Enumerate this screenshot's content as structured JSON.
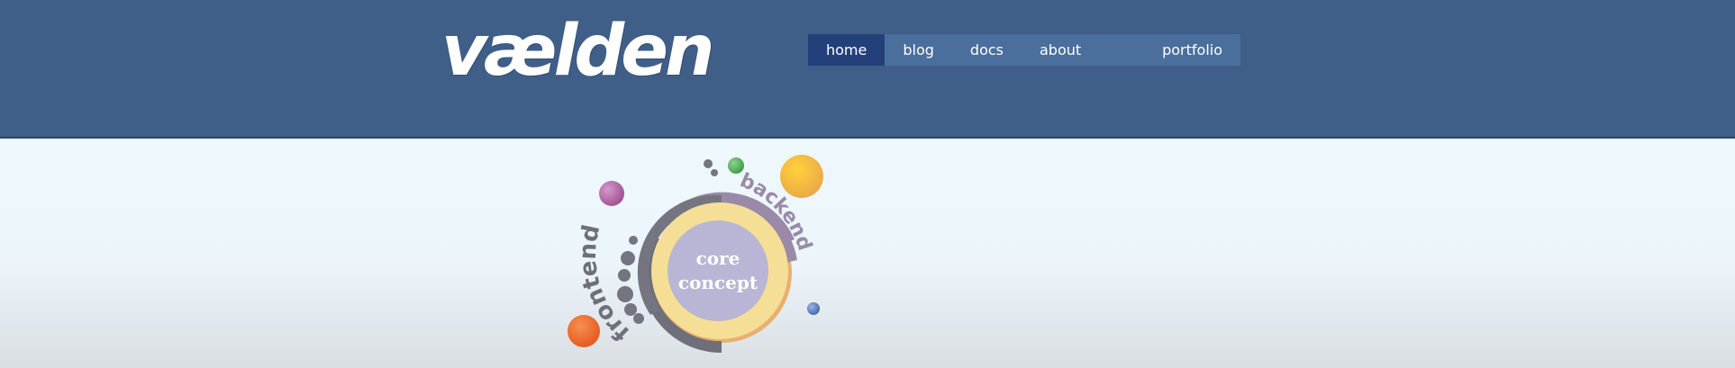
{
  "brand": {
    "logo_text": "vælden"
  },
  "nav": {
    "items": [
      {
        "label": "home",
        "active": true
      },
      {
        "label": "blog",
        "active": false
      },
      {
        "label": "docs",
        "active": false
      },
      {
        "label": "about",
        "active": false
      },
      {
        "label": "portfolio",
        "active": false
      }
    ]
  },
  "graphic": {
    "arc_left_label": "frontend",
    "arc_right_label": "backend",
    "center_line1": "core",
    "center_line2": "concept"
  },
  "colors": {
    "header_bg": "#3f5e88",
    "nav_bg": "#4a6f9c",
    "nav_active_bg": "#24407a",
    "page_bg": "#eef8fc",
    "ring_yellow": "#f5df97",
    "ring_orange_edge": "#e8b070",
    "ring_purple": "#9a8aa8",
    "ring_gray": "#6e6f7a",
    "core_fill": "#b8b6d4",
    "bubble_magenta": "#b066a4",
    "bubble_green": "#5db066",
    "bubble_yellow": "#f5b43a",
    "bubble_orange": "#ef6a2e",
    "bubble_blue": "#5a7ab8"
  }
}
